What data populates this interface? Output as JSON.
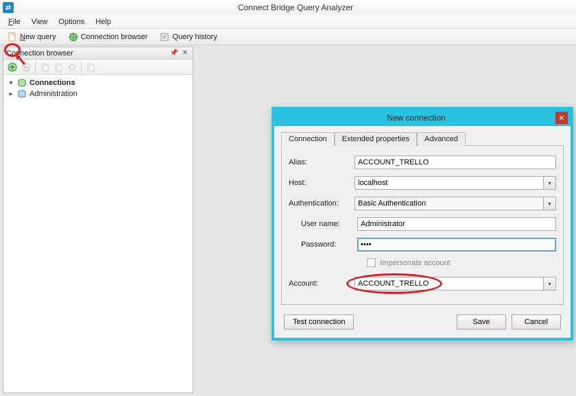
{
  "app": {
    "title": "Connect Bridge Query Analyzer",
    "icon_text": "⇄"
  },
  "menu": {
    "file": "File",
    "view": "View",
    "options": "Options",
    "help": "Help"
  },
  "toolbar": {
    "new_query": "New query",
    "connection_browser": "Connection browser",
    "query_history": "Query history"
  },
  "left_panel": {
    "title": "Connection browser",
    "icon_buttons": {
      "add": "add-connection-icon",
      "remove": "remove-connection-icon",
      "copy1": "copy-icon",
      "copy2": "copy-icon",
      "refresh": "refresh-icon",
      "copy3": "copy-icon"
    },
    "tree": [
      {
        "label": "Connections",
        "bold": true,
        "icon": "db-green"
      },
      {
        "label": "Administration",
        "bold": false,
        "icon": "db-blue"
      }
    ]
  },
  "dialog": {
    "title": "New connection",
    "tabs": [
      "Connection",
      "Extended properties",
      "Advanced"
    ],
    "active_tab": 0,
    "fields": {
      "alias_label": "Alias:",
      "alias_value": "ACCOUNT_TRELLO",
      "host_label": "Host:",
      "host_value": "localhost",
      "auth_label": "Authentication:",
      "auth_value": "Basic Authentication",
      "user_label": "User name:",
      "user_value": "Administrator",
      "pass_label": "Password:",
      "pass_value": "••••",
      "impersonate_label": "Impersonate account",
      "account_label": "Account:",
      "account_value": "ACCOUNT_TRELLO"
    },
    "buttons": {
      "test": "Test connection",
      "save": "Save",
      "cancel": "Cancel"
    }
  }
}
